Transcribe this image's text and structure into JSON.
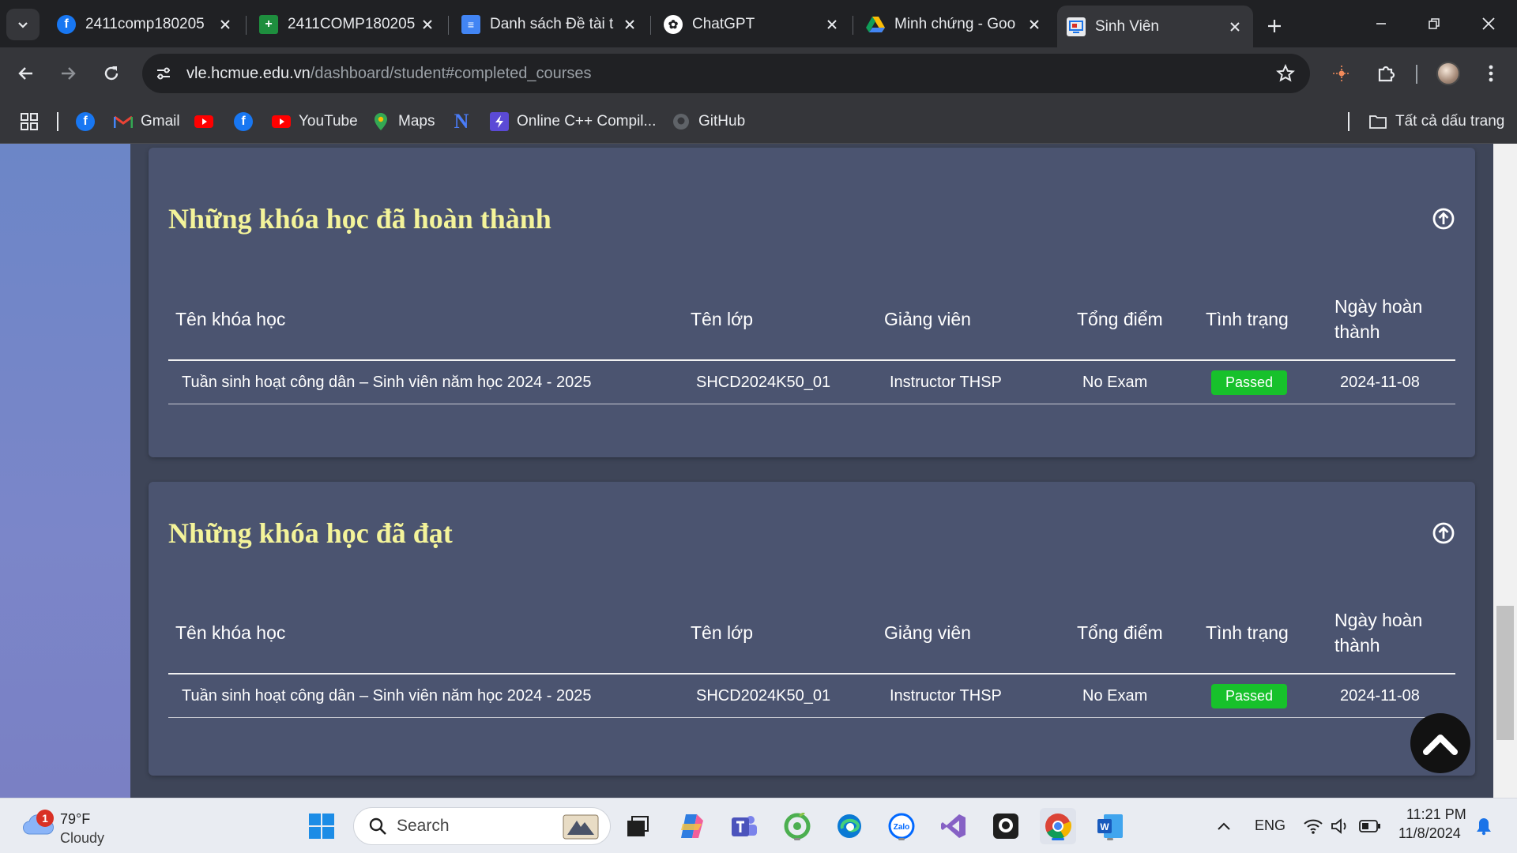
{
  "browser": {
    "tabs": [
      {
        "title": "2411comp180205",
        "icon": "facebook-icon",
        "active": false
      },
      {
        "title": "2411COMP180205",
        "icon": "google-sheets-icon",
        "active": false
      },
      {
        "title": "Danh sách Đề tài t",
        "icon": "google-docs-icon",
        "active": false
      },
      {
        "title": "ChatGPT",
        "icon": "chatgpt-icon",
        "active": false
      },
      {
        "title": "Minh chứng - Goo",
        "icon": "google-drive-icon",
        "active": false
      },
      {
        "title": "Sinh Viên",
        "icon": "site-icon",
        "active": true
      }
    ],
    "url": {
      "host": "vle.hcmue.edu.vn",
      "path": "/dashboard/student#completed_courses"
    },
    "bookmarks": [
      {
        "label": "",
        "icon": "facebook-icon"
      },
      {
        "label": "Gmail",
        "icon": "gmail-icon"
      },
      {
        "label": "",
        "icon": "youtube-icon"
      },
      {
        "label": "",
        "icon": "facebook-icon"
      },
      {
        "label": "YouTube",
        "icon": "youtube-icon"
      },
      {
        "label": "Maps",
        "icon": "maps-icon"
      },
      {
        "label": "",
        "icon": "notion-n-icon"
      },
      {
        "label": "Online C++ Compil...",
        "icon": "bolt-icon"
      },
      {
        "label": "GitHub",
        "icon": "github-icon"
      }
    ],
    "all_bookmarks_label": "Tất cả dấu trang"
  },
  "sections": [
    {
      "title": "Những khóa học đã hoàn thành",
      "columns": [
        "Tên khóa học",
        "Tên lớp",
        "Giảng viên",
        "Tổng điểm",
        "Tình trạng",
        "Ngày hoàn thành"
      ],
      "rows": [
        {
          "course": "Tuần sinh hoạt công dân – Sinh viên năm học 2024 - 2025",
          "class": "SHCD2024K50_01",
          "instructor": "Instructor THSP",
          "score": "No Exam",
          "status": "Passed",
          "date": "2024-11-08"
        }
      ]
    },
    {
      "title": "Những khóa học đã đạt",
      "columns": [
        "Tên khóa học",
        "Tên lớp",
        "Giảng viên",
        "Tổng điểm",
        "Tình trạng",
        "Ngày hoàn thành"
      ],
      "rows": [
        {
          "course": "Tuần sinh hoạt công dân – Sinh viên năm học 2024 - 2025",
          "class": "SHCD2024K50_01",
          "instructor": "Instructor THSP",
          "score": "No Exam",
          "status": "Passed",
          "date": "2024-11-08"
        }
      ]
    }
  ],
  "taskbar": {
    "weather": {
      "temp": "79°F",
      "condition": "Cloudy",
      "badge": "1"
    },
    "search_label": "Search",
    "language": "ENG",
    "time": "11:21 PM",
    "date": "11/8/2024"
  },
  "colors": {
    "section_title": "#f4f49a",
    "card_bg": "#4b5470",
    "passed_badge": "#17c12b",
    "sidebar": "#7b86c9"
  }
}
